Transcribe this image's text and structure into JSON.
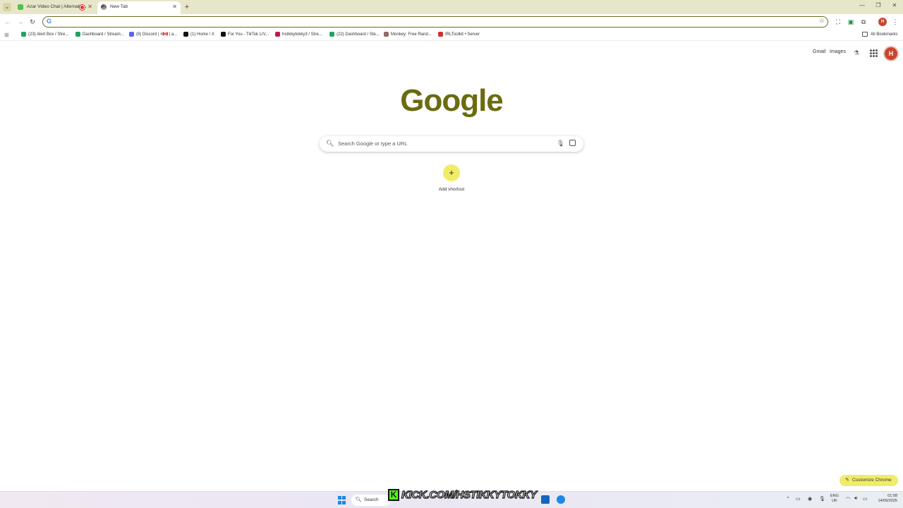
{
  "tabs": [
    {
      "title": "Azar Video Chat | Alternativ..."
    },
    {
      "title": "New Tab"
    }
  ],
  "omnibox": {
    "value": ""
  },
  "bookmarks": [
    {
      "label": "(23) Alert Box / Stre...",
      "color": "#1ea362"
    },
    {
      "label": "Dashboard / Stream...",
      "color": "#1ea362"
    },
    {
      "label": "(8) Discord | #🇨🇦 | a...",
      "color": "#5865f2"
    },
    {
      "label": "(1) Home / X",
      "color": "#111111"
    },
    {
      "label": "For You - TikTok LIV...",
      "color": "#111111"
    },
    {
      "label": "hstikkytokky3 / Stre...",
      "color": "#c2185b"
    },
    {
      "label": "(22) Dashboard / Ste...",
      "color": "#1ea362"
    },
    {
      "label": "Monkey: Free Rand...",
      "color": "#8d6e63"
    },
    {
      "label": "IRLToolkit • Server",
      "color": "#d32f2f"
    }
  ],
  "all_bookmarks_label": "All Bookmarks",
  "ntp": {
    "gmail": "Gmail",
    "images": "Images",
    "profile_initial": "H",
    "logo": "Google",
    "search_placeholder": "Search Google or type a URL",
    "add_shortcut": "Add shortcut",
    "customize": "Customize Chrome"
  },
  "taskbar": {
    "search_label": "Search",
    "overlay_text": "KICK.COM/HSTIKKYTOKKY",
    "overlay_logo": "K",
    "lang_top": "ENG",
    "lang_bottom": "UK",
    "time": "01:08",
    "date": "14/09/2025"
  },
  "colors": {
    "accent": "#6b6b10",
    "highlight": "#f1ec68"
  }
}
